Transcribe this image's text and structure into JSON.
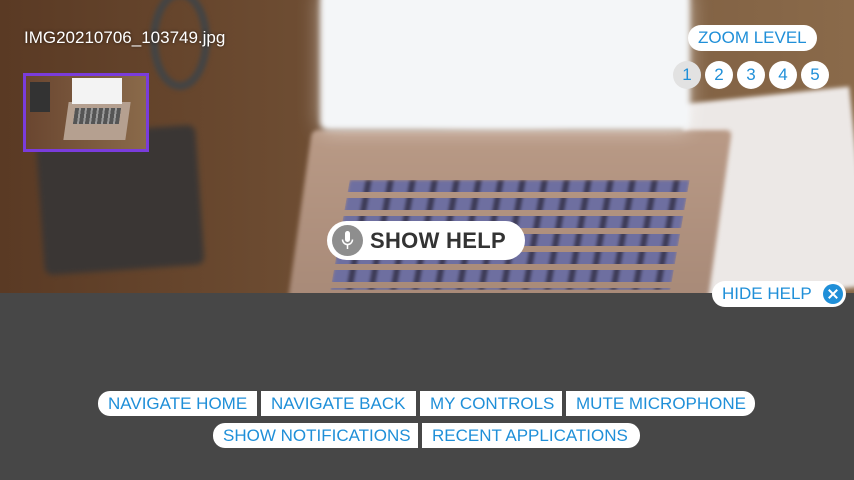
{
  "viewer": {
    "filename": "IMG20210706_103749.jpg"
  },
  "zoom": {
    "label": "ZOOM LEVEL",
    "levels": [
      "1",
      "2",
      "3",
      "4",
      "5"
    ],
    "active": "1"
  },
  "help": {
    "show_label": "SHOW HELP",
    "hide_label": "HIDE HELP"
  },
  "commands": {
    "row1": [
      "NAVIGATE HOME",
      "NAVIGATE BACK",
      "MY CONTROLS",
      "MUTE MICROPHONE"
    ],
    "row2": [
      "SHOW NOTIFICATIONS",
      "RECENT APPLICATIONS"
    ]
  },
  "colors": {
    "accent": "#1f8fd8",
    "thumbnail_border": "#7a3cdc",
    "panel_bg": "#474747"
  },
  "icons": {
    "mic": "microphone-icon",
    "close": "close-icon"
  }
}
